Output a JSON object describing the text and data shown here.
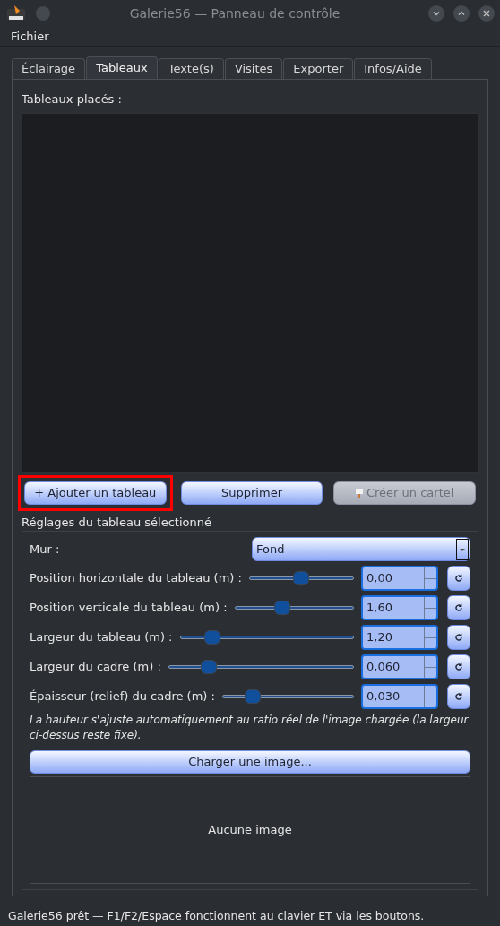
{
  "window": {
    "title": "Galerie56 — Panneau de contrôle"
  },
  "menu": [
    "Fichier"
  ],
  "tabs": [
    {
      "label": "Éclairage",
      "selected": false
    },
    {
      "label": "Tableaux",
      "selected": true
    },
    {
      "label": "Texte(s)",
      "selected": false
    },
    {
      "label": "Visites",
      "selected": false
    },
    {
      "label": "Exporter",
      "selected": false
    },
    {
      "label": "Infos/Aide",
      "selected": false
    }
  ],
  "placed_label": "Tableaux placés :",
  "actions": [
    {
      "label": "+ Ajouter un tableau",
      "disabled": false,
      "highlighted": true
    },
    {
      "label": "Supprimer",
      "disabled": false,
      "highlighted": false
    },
    {
      "label": "Créer un cartel",
      "disabled": true,
      "highlighted": false,
      "kind": "with-sign"
    }
  ],
  "settings": {
    "title": "Réglages du tableau sélectionné",
    "wall": {
      "label": "Mur :",
      "value": "Fond"
    },
    "sliders": [
      {
        "label": "Position horizontale du tableau (m) :",
        "level": 0.5,
        "value": "0,00"
      },
      {
        "label": "Position verticale du tableau (m) :",
        "level": 0.4,
        "value": "1,60"
      },
      {
        "label": "Largeur du tableau (m) :",
        "level": 0.19,
        "value": "1,20"
      },
      {
        "label": "Largeur du cadre (m) :",
        "level": 0.22,
        "value": "0,060"
      },
      {
        "label": "Épaisseur (relief) du cadre (m) :",
        "level": 0.23,
        "value": "0,030"
      }
    ],
    "note": "La hauteur s'ajuste automatiquement au ratio réel de l'image chargée (la largeur ci-dessus reste fixe).",
    "load_button": "Charger une image...",
    "preview": "Aucune image"
  },
  "status_bar": "Galerie56 prêt — F1/F2/Espace fonctionnent au clavier ET via les boutons."
}
